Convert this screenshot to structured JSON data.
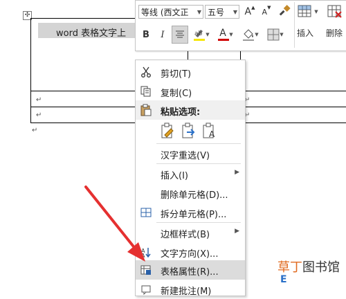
{
  "document": {
    "cell_text": "word 表格文字上",
    "return_mark": "↵",
    "table_anchor": "✣"
  },
  "mini_toolbar": {
    "font_name": "等线 (西文正",
    "font_size": "五号",
    "grow_font": "A",
    "shrink_font": "A",
    "bold": "B",
    "italic": "I",
    "font_color_letter": "A",
    "insert_label": "插入",
    "delete_label": "删除",
    "highlight_color": "#f5e600",
    "font_color": "#d00000"
  },
  "context_menu": {
    "items": [
      {
        "label": "剪切(T)",
        "icon": "scissors-icon"
      },
      {
        "label": "复制(C)",
        "icon": "copy-icon"
      },
      {
        "label": "粘贴选项:",
        "icon": "paste-icon"
      },
      {
        "label": "汉字重选(V)",
        "icon": ""
      },
      {
        "label": "插入(I)",
        "icon": ""
      },
      {
        "label": "删除单元格(D)...",
        "icon": ""
      },
      {
        "label": "拆分单元格(P)...",
        "icon": "split-cells-icon"
      },
      {
        "label": "边框样式(B)",
        "icon": ""
      },
      {
        "label": "文字方向(X)...",
        "icon": "text-direction-icon"
      },
      {
        "label": "表格属性(R)...",
        "icon": "table-properties-icon"
      },
      {
        "label": "新建批注(M)",
        "icon": "new-comment-icon"
      }
    ],
    "paste_options": [
      "keep-source-formatting-icon",
      "merge-formatting-icon",
      "keep-text-only-icon"
    ]
  },
  "watermark": {
    "text1": "草丁",
    "text2": "图书馆"
  },
  "colors": {
    "arrow": "#e53030",
    "menu_highlight": "#dcdcdc"
  }
}
